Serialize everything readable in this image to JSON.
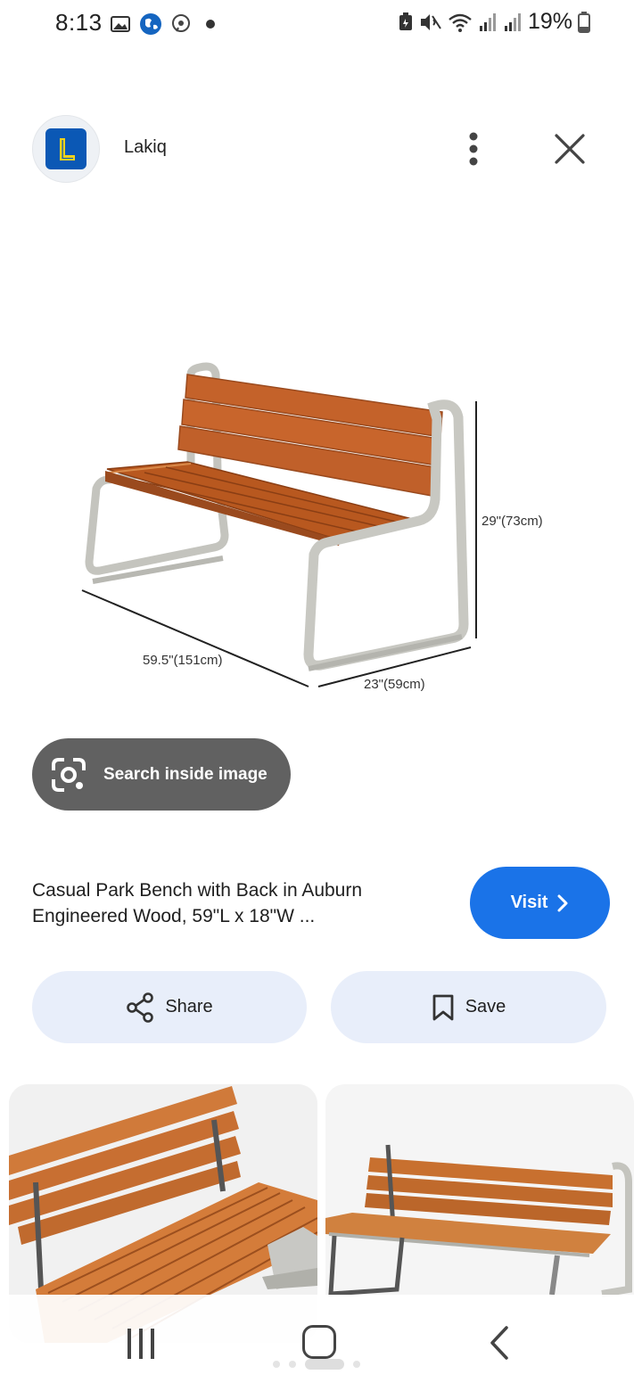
{
  "status_bar": {
    "time": "8:13",
    "battery_percent": "19%",
    "left_icons": [
      "gallery-icon",
      "globe-icon",
      "messenger-icon",
      "dot-icon"
    ],
    "right_icons": [
      "battery-saver-icon",
      "mute-icon",
      "wifi-icon",
      "signal-icon",
      "signal-icon",
      "battery-icon"
    ]
  },
  "header": {
    "source_name": "Lakiq",
    "source_logo_letter": "L"
  },
  "main_image": {
    "dimension_length": "59.5\"(151cm)",
    "dimension_width": "23\"(59cm)",
    "dimension_height": "29\"(73cm)"
  },
  "lens": {
    "label": "Search inside image"
  },
  "result": {
    "title": "Casual Park Bench with Back in Auburn Engineered Wood, 59\"L x 18\"W ...",
    "visit_label": "Visit"
  },
  "actions": {
    "share_label": "Share",
    "save_label": "Save"
  },
  "colors": {
    "accent_blue": "#1a73e8",
    "pill_bg": "#e8eefa",
    "chip_bg": "#616161",
    "wood": "#c0622a",
    "steel": "#c8c8c4"
  }
}
